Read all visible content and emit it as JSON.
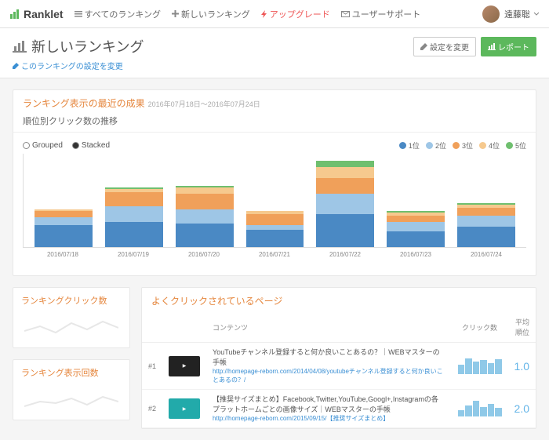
{
  "brand": "Ranklet",
  "nav": {
    "all": "すべてのランキング",
    "new": "新しいランキング",
    "upgrade": "アップグレード",
    "support": "ユーザーサポート"
  },
  "user": {
    "name": "遠藤聡"
  },
  "page": {
    "title": "新しいランキング",
    "edit_link": "このランキングの設定を変更",
    "btn_settings": "設定を変更",
    "btn_report": "レポート"
  },
  "section": {
    "heading": "ランキング表示の最近の成果",
    "range": "2016年07月18日～2016年07月24日",
    "chart_title": "順位別クリック数の推移"
  },
  "mode": {
    "grouped": "Grouped",
    "stacked": "Stacked"
  },
  "legend": {
    "r1": "1位",
    "r2": "2位",
    "r3": "3位",
    "r4": "4位",
    "r5": "5位"
  },
  "chart_data": {
    "type": "bar",
    "stacked": true,
    "ylim": [
      0,
      120
    ],
    "categories": [
      "2016/07/18",
      "2016/07/19",
      "2016/07/20",
      "2016/07/21",
      "2016/07/22",
      "2016/07/23",
      "2016/07/24"
    ],
    "series": [
      {
        "name": "1位",
        "color": "#4a89c4",
        "values": [
          28,
          32,
          30,
          22,
          42,
          20,
          26
        ]
      },
      {
        "name": "2位",
        "color": "#9ec6e6",
        "values": [
          10,
          20,
          18,
          6,
          26,
          12,
          14
        ]
      },
      {
        "name": "3位",
        "color": "#f0a05a",
        "values": [
          8,
          18,
          20,
          14,
          20,
          8,
          10
        ]
      },
      {
        "name": "4位",
        "color": "#f6c98e",
        "values": [
          2,
          4,
          8,
          4,
          14,
          4,
          4
        ]
      },
      {
        "name": "5位",
        "color": "#6fbf6f",
        "values": [
          0,
          2,
          2,
          0,
          8,
          2,
          2
        ]
      }
    ]
  },
  "cards": {
    "clicks": "ランキングクリック数",
    "impressions": "ランキング表示回数"
  },
  "pages": {
    "heading": "よくクリックされているページ",
    "th": {
      "content": "コンテンツ",
      "clicks": "クリック数",
      "avg": "平均順位"
    },
    "rows": [
      {
        "rank": "#1",
        "title": "YouTubeチャンネル登録すると何か良いことあるの？｜WEBマスターの手帳",
        "url": "http://homepage-reborn.com/2014/04/08/youtubeチャンネル登録すると何か良いことあるの？/",
        "avg": "1.0",
        "spark": [
          60,
          100,
          80,
          90,
          70,
          95
        ]
      },
      {
        "rank": "#2",
        "title": "【推奨サイズまとめ】Facebook,Twitter,YouTube,Googl+,Instagramの各プラットホームごとの画像サイズ｜WEBマスターの手帳",
        "url": "http://homepage-reborn.com/2015/09/15/【推奨サイズまとめ】",
        "avg": "2.0",
        "spark": [
          40,
          70,
          100,
          60,
          80,
          55
        ]
      }
    ]
  }
}
